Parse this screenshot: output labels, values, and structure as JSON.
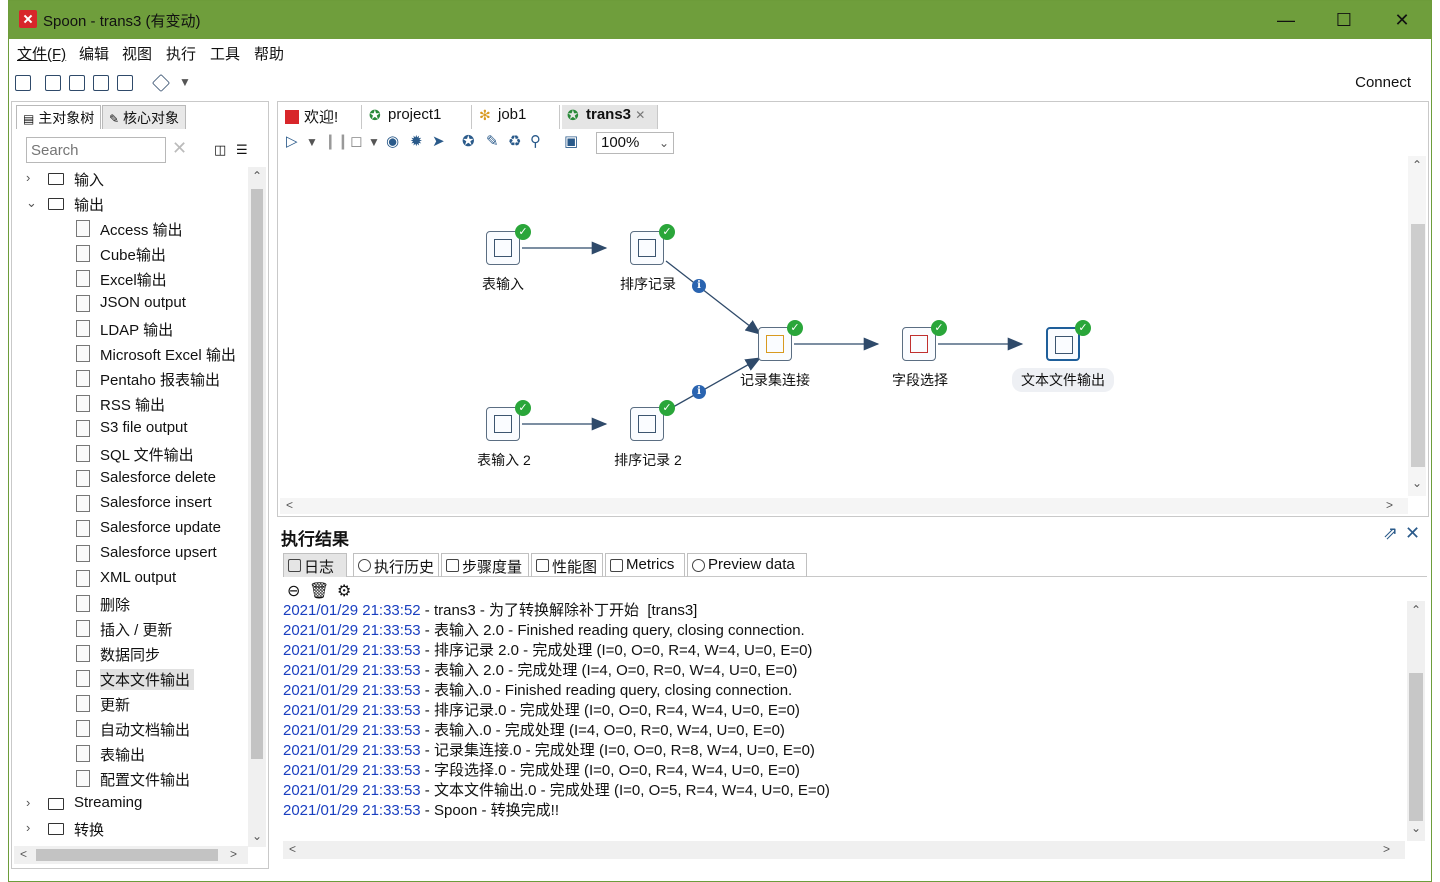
{
  "window": {
    "title": "Spoon - trans3 (有变动)"
  },
  "menu": [
    "文件(F)",
    "编辑",
    "视图",
    "执行",
    "工具",
    "帮助"
  ],
  "toolbar": {
    "connect_label": "Connect"
  },
  "left_panel": {
    "tabs": [
      "主对象树",
      "核心对象"
    ],
    "search_placeholder": "Search",
    "tree": [
      {
        "label": "输入",
        "type": "folder",
        "expanded": false
      },
      {
        "label": "输出",
        "type": "folder",
        "expanded": true
      },
      {
        "label": "Access 输出",
        "type": "leaf"
      },
      {
        "label": "Cube输出",
        "type": "leaf"
      },
      {
        "label": "Excel输出",
        "type": "leaf"
      },
      {
        "label": "JSON output",
        "type": "leaf"
      },
      {
        "label": "LDAP 输出",
        "type": "leaf"
      },
      {
        "label": "Microsoft Excel 输出",
        "type": "leaf"
      },
      {
        "label": "Pentaho 报表输出",
        "type": "leaf"
      },
      {
        "label": "RSS 输出",
        "type": "leaf"
      },
      {
        "label": "S3 file output",
        "type": "leaf"
      },
      {
        "label": "SQL 文件输出",
        "type": "leaf"
      },
      {
        "label": "Salesforce delete",
        "type": "leaf"
      },
      {
        "label": "Salesforce insert",
        "type": "leaf"
      },
      {
        "label": "Salesforce update",
        "type": "leaf"
      },
      {
        "label": "Salesforce upsert",
        "type": "leaf"
      },
      {
        "label": "XML output",
        "type": "leaf"
      },
      {
        "label": "删除",
        "type": "leaf"
      },
      {
        "label": "插入 / 更新",
        "type": "leaf"
      },
      {
        "label": "数据同步",
        "type": "leaf"
      },
      {
        "label": "文本文件输出",
        "type": "leaf",
        "selected": true
      },
      {
        "label": "更新",
        "type": "leaf"
      },
      {
        "label": "自动文档输出",
        "type": "leaf"
      },
      {
        "label": "表输出",
        "type": "leaf"
      },
      {
        "label": "配置文件输出",
        "type": "leaf"
      },
      {
        "label": "Streaming",
        "type": "folder",
        "expanded": false
      },
      {
        "label": "转换",
        "type": "folder",
        "expanded": false
      }
    ]
  },
  "editor": {
    "tabs": [
      {
        "label": "欢迎!",
        "active": false
      },
      {
        "label": "project1",
        "active": false
      },
      {
        "label": "job1",
        "active": false
      },
      {
        "label": "trans3",
        "active": true
      }
    ],
    "zoom": "100%",
    "steps": [
      {
        "id": "s1",
        "label": "表输入"
      },
      {
        "id": "s2",
        "label": "排序记录"
      },
      {
        "id": "s3",
        "label": "记录集连接"
      },
      {
        "id": "s4",
        "label": "字段选择"
      },
      {
        "id": "s5",
        "label": "文本文件输出"
      },
      {
        "id": "s6",
        "label": "表输入 2"
      },
      {
        "id": "s7",
        "label": "排序记录 2"
      }
    ]
  },
  "results": {
    "title": "执行结果",
    "tabs": [
      "日志",
      "执行历史",
      "步骤度量",
      "性能图",
      "Metrics",
      "Preview data"
    ],
    "log": [
      {
        "ts": "2021/01/29 21:33:52",
        "msg": " - trans3 - 为了转换解除补丁开始  [trans3]"
      },
      {
        "ts": "2021/01/29 21:33:53",
        "msg": " - 表输入 2.0 - Finished reading query, closing connection."
      },
      {
        "ts": "2021/01/29 21:33:53",
        "msg": " - 排序记录 2.0 - 完成处理 (I=0, O=0, R=4, W=4, U=0, E=0)"
      },
      {
        "ts": "2021/01/29 21:33:53",
        "msg": " - 表输入 2.0 - 完成处理 (I=4, O=0, R=0, W=4, U=0, E=0)"
      },
      {
        "ts": "2021/01/29 21:33:53",
        "msg": " - 表输入.0 - Finished reading query, closing connection."
      },
      {
        "ts": "2021/01/29 21:33:53",
        "msg": " - 排序记录.0 - 完成处理 (I=0, O=0, R=4, W=4, U=0, E=0)"
      },
      {
        "ts": "2021/01/29 21:33:53",
        "msg": " - 表输入.0 - 完成处理 (I=4, O=0, R=0, W=4, U=0, E=0)"
      },
      {
        "ts": "2021/01/29 21:33:53",
        "msg": " - 记录集连接.0 - 完成处理 (I=0, O=0, R=8, W=4, U=0, E=0)"
      },
      {
        "ts": "2021/01/29 21:33:53",
        "msg": " - 字段选择.0 - 完成处理 (I=0, O=0, R=4, W=4, U=0, E=0)"
      },
      {
        "ts": "2021/01/29 21:33:53",
        "msg": " - 文本文件输出.0 - 完成处理 (I=0, O=5, R=4, W=4, U=0, E=0)"
      },
      {
        "ts": "2021/01/29 21:33:53",
        "msg": " - Spoon - 转换完成!!"
      }
    ]
  }
}
